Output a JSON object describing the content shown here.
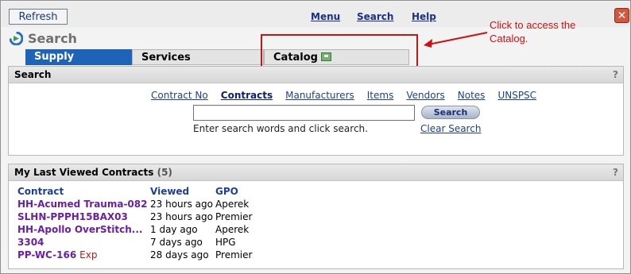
{
  "toolbar": {
    "refresh_label": "Refresh",
    "menu_label": "Menu",
    "search_label": "Search",
    "help_label": "Help",
    "close_icon": "close-icon"
  },
  "page": {
    "title": "Search",
    "logo_icon": "app-logo-icon"
  },
  "tabs": [
    {
      "label": "Supply",
      "active": true
    },
    {
      "label": "Services",
      "active": false
    },
    {
      "label": "Catalog",
      "active": false,
      "icon": "external-link-icon"
    }
  ],
  "callout": {
    "text": "Click to access the Catalog.",
    "color": "#d01010"
  },
  "search_panel": {
    "title": "Search",
    "help": "?",
    "links": [
      {
        "label": "Contract No",
        "active": false
      },
      {
        "label": "Contracts",
        "active": true
      },
      {
        "label": "Manufacturers",
        "active": false
      },
      {
        "label": "Items",
        "active": false
      },
      {
        "label": "Vendors",
        "active": false
      },
      {
        "label": "Notes",
        "active": false
      },
      {
        "label": "UNSPSC",
        "active": false
      }
    ],
    "input_value": "",
    "button_label": "Search",
    "hint": "Enter search words and click search.",
    "clear_label": "Clear Search"
  },
  "recent_panel": {
    "title": "My Last Viewed Contracts",
    "count": "(5)",
    "help": "?",
    "columns": [
      "Contract",
      "Viewed",
      "GPO"
    ],
    "rows": [
      {
        "contract": "HH-Acumed Trauma-082",
        "flag": "",
        "viewed": "23 hours ago",
        "gpo": "Aperek"
      },
      {
        "contract": "SLHN-PPPH15BAX03",
        "flag": "",
        "viewed": "23 hours ago",
        "gpo": "Premier"
      },
      {
        "contract": "HH-Apollo OverStitch...",
        "flag": "",
        "viewed": "1 day ago",
        "gpo": "Aperek"
      },
      {
        "contract": "3304",
        "flag": "",
        "viewed": "7 days ago",
        "gpo": "HPG"
      },
      {
        "contract": "PP-WC-166",
        "flag": "Exp",
        "viewed": "28 days ago",
        "gpo": "Premier"
      }
    ]
  },
  "colors": {
    "accent": "#1f63b8",
    "link": "#1c3f9a",
    "contract_link": "#6b1fa8"
  }
}
